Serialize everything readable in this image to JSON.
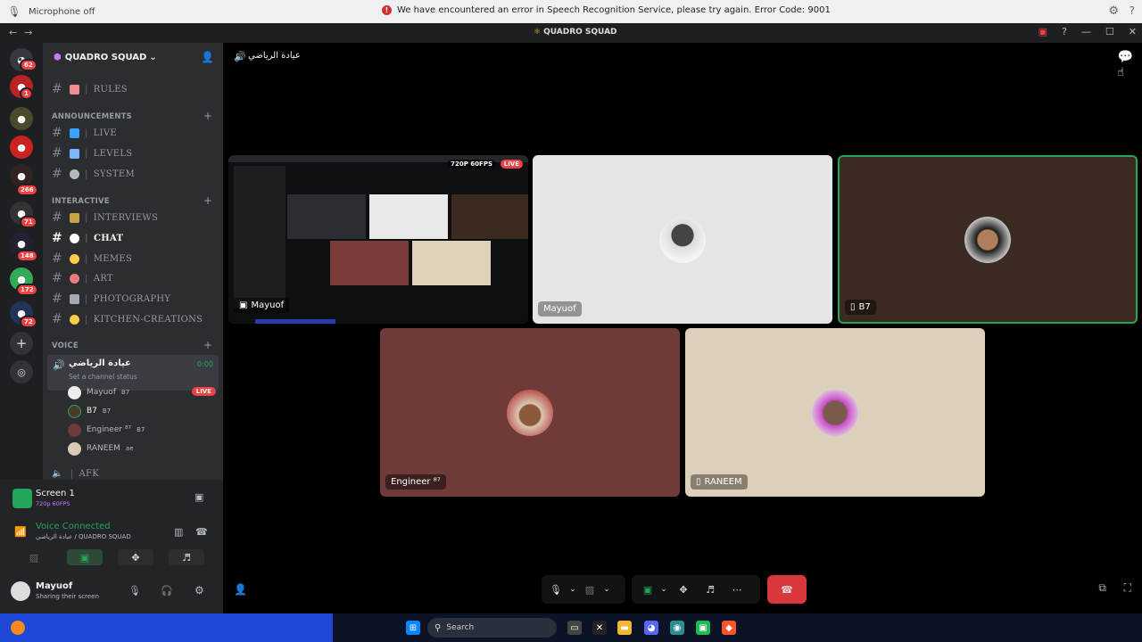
{
  "notice": {
    "mic_label": "Microphone off",
    "error_message": "We have encountered an error in Speech Recognition Service, please try again. Error Code: 9001"
  },
  "titlebar": {
    "title": "QUADRO SQUAD"
  },
  "servers": {
    "badges": [
      "62",
      "1",
      "266",
      "71",
      "148",
      "172",
      "72"
    ]
  },
  "sidebar": {
    "server_name": "QUADRO SQUAD",
    "channels_top": [
      {
        "name": "RULES",
        "emoji_color": "#f28c8c"
      }
    ],
    "categories": {
      "announcements": "ANNOUNCEMENTS",
      "interactive": "INTERACTIVE",
      "voice": "VOICE"
    },
    "announcements": [
      {
        "name": "LIVE",
        "emoji_color": "#3aa0ff"
      },
      {
        "name": "LEVELS",
        "emoji_color": "#7ab7ff"
      },
      {
        "name": "SYSTEM",
        "emoji_color": "#b5bac1"
      }
    ],
    "interactive": [
      {
        "name": "INTERVIEWS",
        "emoji_color": "#c9a24a"
      },
      {
        "name": "CHAT",
        "emoji_color": "#ffffff",
        "active": true
      },
      {
        "name": "MEMES",
        "emoji_color": "#ffcc4d"
      },
      {
        "name": "ART",
        "emoji_color": "#e87b7b"
      },
      {
        "name": "PHOTOGRAPHY",
        "emoji_color": "#a4a9b3"
      },
      {
        "name": "KITCHEN-CREATIONS",
        "emoji_color": "#f7d046"
      }
    ],
    "voice_channel": {
      "name": "عيادة الرياضي",
      "timer": "0:00",
      "status_placeholder": "Set a channel status"
    },
    "voice_members": [
      {
        "name": "Mayuof",
        "tag": "B7",
        "live": "LIVE"
      },
      {
        "name": "B7",
        "tag": "B7"
      },
      {
        "name": "Engineer ⁸⁷",
        "tag": "B7"
      },
      {
        "name": "RANEEM",
        "tag": "ae"
      }
    ],
    "afk": "AFK"
  },
  "panel": {
    "screen_title": "Screen 1",
    "screen_quality": "720p 60FPS",
    "voice_status": "Voice Connected",
    "voice_location": "عيادة الرياضي / QUADRO SQUAD",
    "user_name": "Mayuof",
    "user_status": "Sharing their screen"
  },
  "stage": {
    "channel_title": "عيادة الرياضي",
    "stream_quality": "720P 60FPS",
    "stream_live": "LIVE",
    "tiles": {
      "stream": "Mayuof",
      "mayuof": "Mayuof",
      "b7": "B7",
      "engineer": "Engineer ⁸⁷",
      "raneem": "RANEEM"
    }
  },
  "taskbar": {
    "search_placeholder": "Search"
  },
  "colors": {
    "end_call": "#da373c",
    "voice_green": "#23a55a",
    "live_red": "#ed4245"
  }
}
